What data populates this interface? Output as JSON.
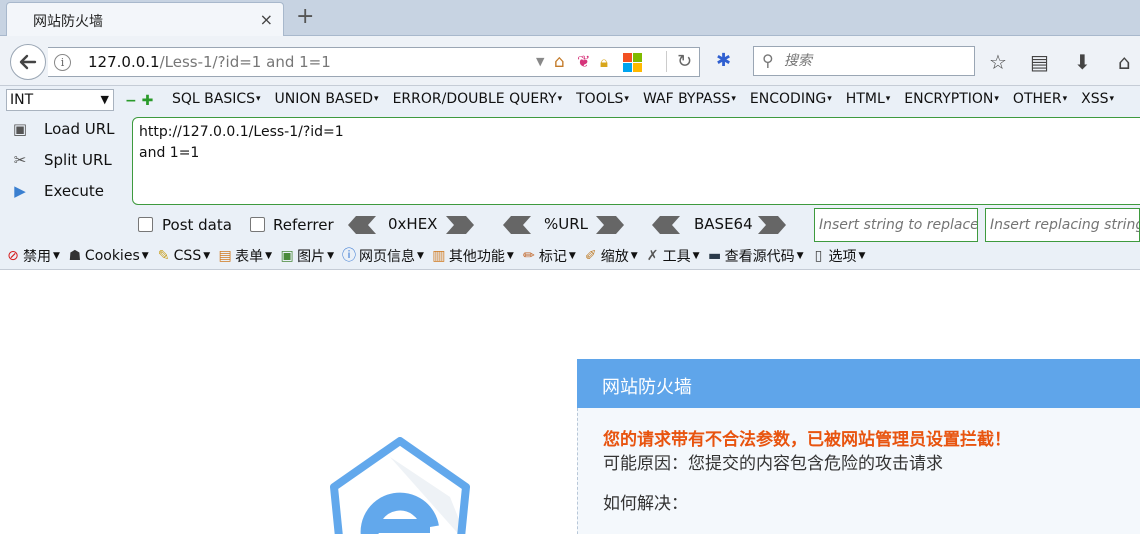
{
  "tab": {
    "title": "网站防火墙",
    "close": "×",
    "new_tab": "+"
  },
  "navbar": {
    "url_host": "127.0.0.1",
    "url_path": "/Less-1/?id=1 and 1=1",
    "search_placeholder": "搜索"
  },
  "hackbar": {
    "type_select": "INT",
    "menus": [
      "SQL BASICS",
      "UNION BASED",
      "ERROR/DOUBLE QUERY",
      "TOOLS",
      "WAF BYPASS",
      "ENCODING",
      "HTML",
      "ENCRYPTION",
      "OTHER",
      "XSS"
    ],
    "load_url": "Load URL",
    "split_url": "Split URL",
    "execute": "Execute",
    "url_value": "http://127.0.0.1/Less-1/?id=1\nand 1=1",
    "post_data": "Post data",
    "referrer": "Referrer",
    "hex": "0xHEX",
    "url_enc": "%URL",
    "base64": "BASE64",
    "insert_placeholder": "Insert string to replace",
    "replacing_placeholder": "Insert replacing string"
  },
  "devbar": {
    "items": [
      "禁用",
      "Cookies",
      "CSS",
      "表单",
      "图片",
      "网页信息",
      "其他功能",
      "标记",
      "缩放",
      "工具",
      "查看源代码",
      "选项"
    ]
  },
  "firewall": {
    "title": "网站防火墙",
    "warning": "您的请求带有不合法参数，已被网站管理员设置拦截！",
    "reason": "可能原因：您提交的内容包含危险的攻击请求",
    "how": "如何解决："
  },
  "colors": {
    "accent_blue": "#5fa5ea",
    "warning_orange": "#e8540f",
    "hackbar_green": "#3e9a3e"
  }
}
